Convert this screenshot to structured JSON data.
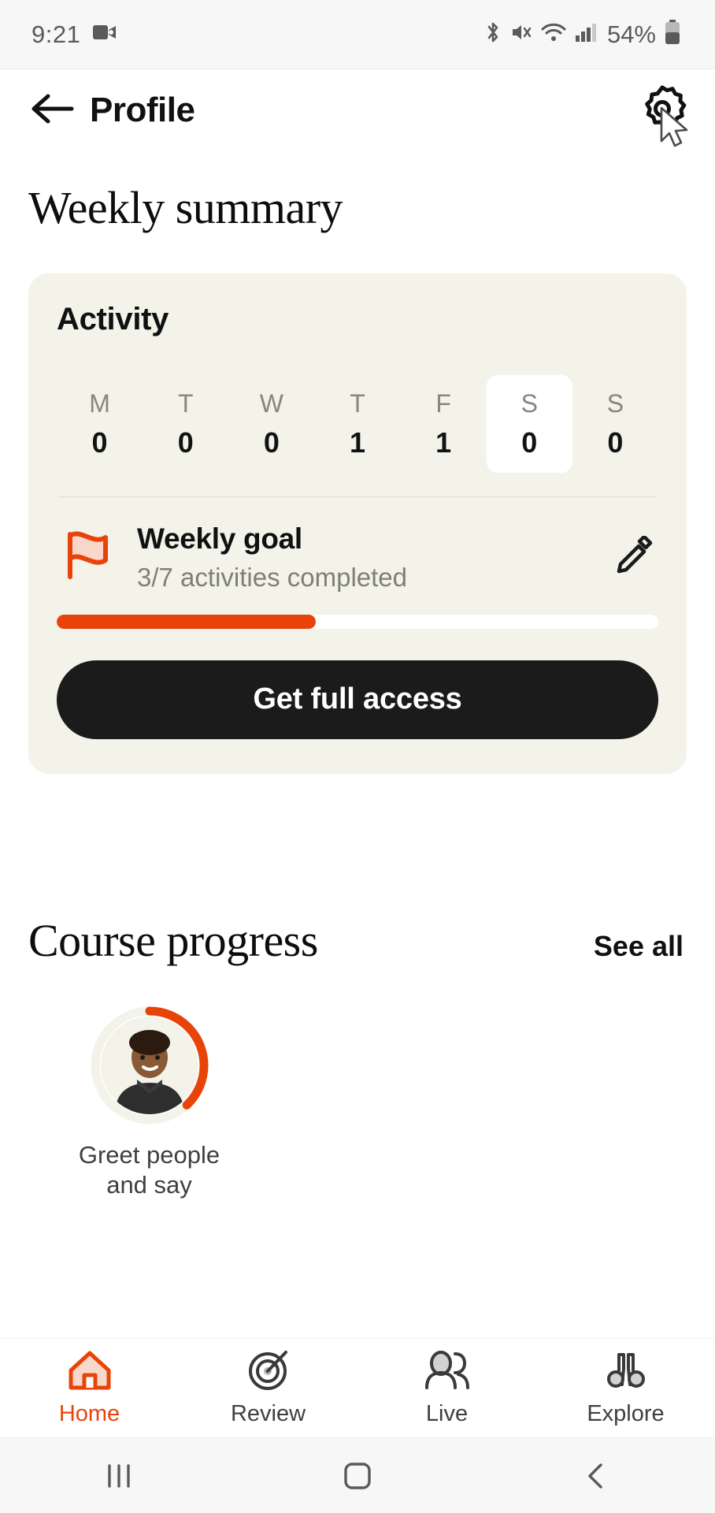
{
  "statusbar": {
    "time": "9:21",
    "battery_percent": "54%",
    "icons": [
      "video-camera-icon",
      "bluetooth-icon",
      "mute-icon",
      "wifi-icon",
      "cellular-signal-icon",
      "battery-icon"
    ]
  },
  "header": {
    "title": "Profile",
    "back_icon": "arrow-left-icon",
    "settings_icon": "gear-icon",
    "cursor": "mouse-pointer"
  },
  "weekly_summary": {
    "title": "Weekly summary",
    "activity": {
      "heading": "Activity",
      "days": [
        {
          "letter": "M",
          "count": "0",
          "active": false
        },
        {
          "letter": "T",
          "count": "0",
          "active": false
        },
        {
          "letter": "W",
          "count": "0",
          "active": false
        },
        {
          "letter": "T",
          "count": "1",
          "active": false
        },
        {
          "letter": "F",
          "count": "1",
          "active": false
        },
        {
          "letter": "S",
          "count": "0",
          "active": true
        },
        {
          "letter": "S",
          "count": "0",
          "active": false
        }
      ],
      "goal": {
        "icon": "flag-icon",
        "title": "Weekly goal",
        "subtitle": "3/7 activities completed",
        "edit_icon": "pencil-icon",
        "progress_percent": 43,
        "completed": 3,
        "target": 7
      },
      "cta_label": "Get full access"
    }
  },
  "course_progress": {
    "title": "Course progress",
    "see_all_label": "See all",
    "items": [
      {
        "label": "Greet people and say",
        "ring_percent": 38,
        "avatar": "person-avatar"
      }
    ]
  },
  "bottom_nav": {
    "items": [
      {
        "label": "Home",
        "icon": "home-icon",
        "active": true
      },
      {
        "label": "Review",
        "icon": "target-icon",
        "active": false
      },
      {
        "label": "Live",
        "icon": "people-icon",
        "active": false
      },
      {
        "label": "Explore",
        "icon": "binoculars-icon",
        "active": false
      }
    ]
  },
  "system_nav": {
    "recents": "recents-button",
    "home": "home-button",
    "back": "back-button"
  },
  "colors": {
    "accent": "#e8440a",
    "card_bg": "#f3f3e9",
    "cta_bg": "#1b1b1b",
    "text": "#111111"
  }
}
